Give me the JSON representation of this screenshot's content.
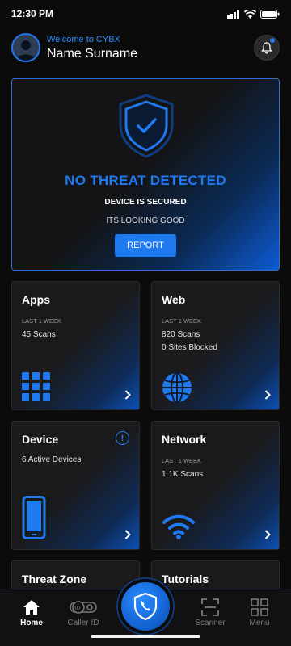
{
  "status_bar": {
    "time": "12:30 PM"
  },
  "header": {
    "welcome": "Welcome to CYBX",
    "name": "Name Surname"
  },
  "hero": {
    "title": "NO THREAT DETECTED",
    "subtitle": "DEVICE IS SECURED",
    "message": "ITS LOOKING GOOD",
    "button": "REPORT"
  },
  "cards": {
    "apps": {
      "title": "Apps",
      "period": "LAST 1 WEEK",
      "line1": "45 Scans"
    },
    "web": {
      "title": "Web",
      "period": "LAST 1 WEEK",
      "line1": "820 Scans",
      "line2": "0 Sites Blocked"
    },
    "device": {
      "title": "Device",
      "line1": "6 Active Devices",
      "alert": "!"
    },
    "network": {
      "title": "Network",
      "period": "LAST 1 WEEK",
      "line1": "1.1K Scans"
    },
    "threat_zone": {
      "title": "Threat Zone"
    },
    "tutorials": {
      "title": "Tutorials"
    }
  },
  "nav": {
    "home": "Home",
    "caller_id": "Caller ID",
    "scanner": "Scanner",
    "menu": "Menu"
  },
  "colors": {
    "accent": "#1f7af0",
    "background": "#0b0b0c",
    "card": "#1a1a1c"
  }
}
